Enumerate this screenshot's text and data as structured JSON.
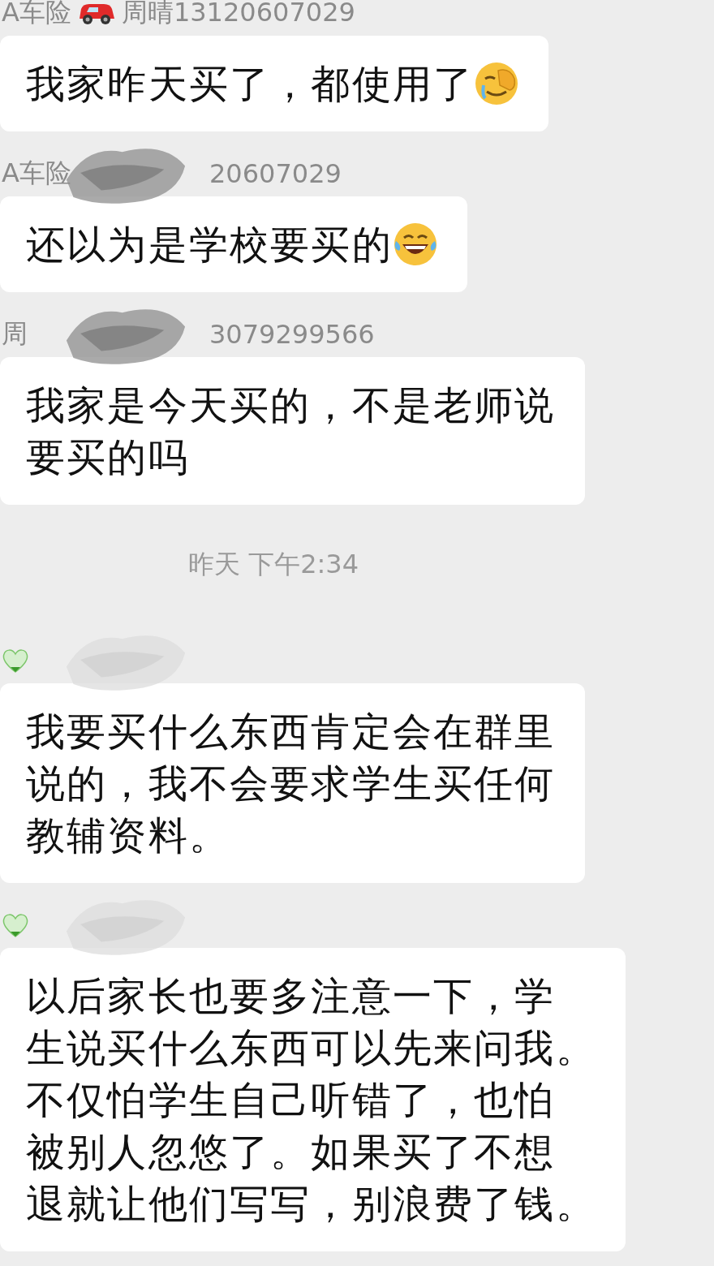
{
  "chat": [
    {
      "kind": "sender",
      "texts": [
        "A车险",
        "周晴13120607029"
      ]
    },
    {
      "kind": "emoji_message",
      "lines": [
        "我家昨天买了，都使用了"
      ]
    },
    {
      "kind": "masked_sender",
      "texts": [
        "A车险",
        "20607029"
      ]
    },
    {
      "kind": "emoji_message",
      "lines": [
        "还以为是学校要买的"
      ]
    },
    {
      "kind": "masked_sender",
      "texts": [
        "周",
        "3079299566"
      ]
    },
    {
      "kind": "message",
      "lines": [
        "我家是今天买的，不是老师说",
        "要买的吗"
      ]
    },
    {
      "kind": "time",
      "text": "昨天 下午2:34"
    },
    {
      "kind": "heart_sender"
    },
    {
      "kind": "message",
      "lines": [
        "我要买什么东西肯定会在群里",
        "说的，我不会要求学生买任何",
        "教辅资料。"
      ]
    },
    {
      "kind": "heart_sender"
    },
    {
      "kind": "message",
      "lines": [
        "以后家长也要多注意一下，学",
        "生说买什么东西可以先来问我。",
        "不仅怕学生自己听错了，也怕",
        "被别人忽悠了。如果买了不想",
        "退就让他们写写，别浪费了钱。"
      ]
    }
  ]
}
